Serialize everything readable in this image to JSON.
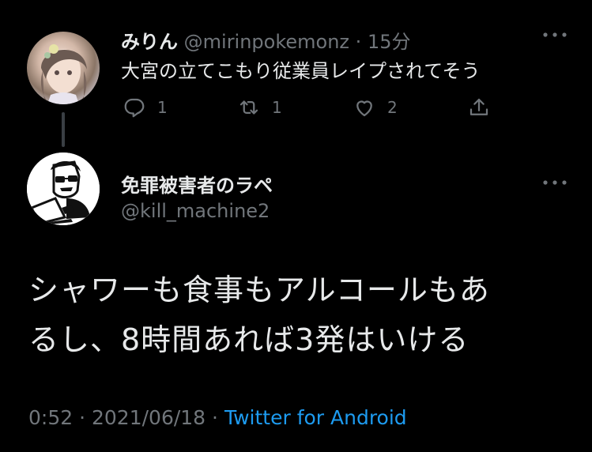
{
  "reply_to": {
    "display_name": "みりん",
    "handle": "@mirinpokemonz",
    "separator": "·",
    "time": "15分",
    "text": "大宮の立てこもり従業員レイプされてそう",
    "actions": {
      "reply_count": "1",
      "retweet_count": "1",
      "like_count": "2"
    }
  },
  "main_tweet": {
    "display_name": "免罪被害者のラペ",
    "handle": "@kill_machine2",
    "text_line1": "シャワーも食事もアルコールもあ",
    "text_line2": "るし、8時間あれば3発はいける",
    "time": "0:52",
    "date": "2021/06/18",
    "client": "Twitter for Android",
    "sep": "·"
  },
  "icons": [
    "reply-icon",
    "retweet-icon",
    "like-icon",
    "share-icon",
    "more-icon"
  ],
  "colors": {
    "background": "#000000",
    "text": "#e7e9ea",
    "muted": "#71767b",
    "link": "#1d9bf0"
  }
}
